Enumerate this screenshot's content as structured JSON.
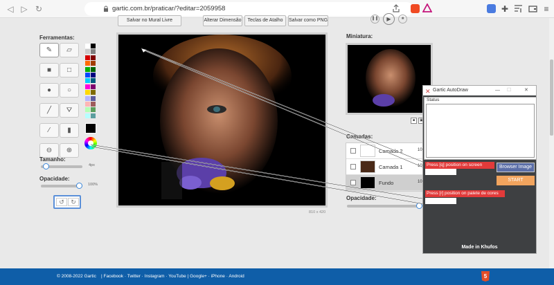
{
  "browser": {
    "url": "gartic.com.br/praticar/?editar=2059958"
  },
  "toolbar": {
    "mural_button": "Salvar no Mural Livre",
    "resize_button": "Alterar Dimensão",
    "shortcuts_button": "Teclas de Atalho",
    "save_png_button": "Salvar como PNG"
  },
  "tools_panel": {
    "heading": "Ferramentas:",
    "size_heading": "Tamanho:",
    "size_value": "4px",
    "size_level": 0.05,
    "opacity_heading": "Opacidade:",
    "opacity_value": "100%",
    "opacity_level": 1.0,
    "tools": [
      "pencil-icon",
      "eraser-icon",
      "filled-rect-icon",
      "rect-outline-icon",
      "filled-circle-icon",
      "circle-outline-icon",
      "line-icon",
      "fill-bucket-icon",
      "eyedropper-icon",
      "blur-icon",
      "zoom-out-icon",
      "zoom-in-icon"
    ],
    "palette": [
      "#ffffff",
      "#000000",
      "#cccccc",
      "#7f7f7f",
      "#d70000",
      "#7f0000",
      "#ff6a00",
      "#a33c00",
      "#00b000",
      "#006400",
      "#0047ff",
      "#00007f",
      "#00cfff",
      "#005d7f",
      "#ff00dc",
      "#7f006e",
      "#ffd800",
      "#7f6a00",
      "#b5b5ff",
      "#5b5b9e",
      "#ffb5b5",
      "#9e5b5b",
      "#b5ffb5",
      "#5b9e5b",
      "#b5ffff",
      "#5b9e9e"
    ],
    "current_color": "#000000"
  },
  "canvas": {
    "dimensions": "810 x 420"
  },
  "right_panel": {
    "thumbnail_heading": "Miniatura:",
    "layers_heading": "Camadas:",
    "layers": [
      {
        "name": "Camada 2",
        "opacity": "10"
      },
      {
        "name": "Camada 1",
        "opacity": "10"
      },
      {
        "name": "Fundo",
        "opacity": "10"
      }
    ],
    "opacity_heading": "Opacidade:",
    "opacity_level": 1.0
  },
  "autodraw": {
    "title": "Gartic AutoDraw",
    "status_label": "Status",
    "press_q": "Press [q] position on screen",
    "press_r": "Press [r] position on palete de cores",
    "browser_image_button": "Browser Image",
    "start_button": "START",
    "credit": "Made in Khufos"
  },
  "footer": {
    "copyright": "© 2008-2022 Gartic",
    "links": [
      "Facebook",
      "Twitter",
      "Instagram",
      "YouTube",
      "Google+",
      "iPhone",
      "Android"
    ],
    "html5_badge": "5"
  },
  "colors": {
    "footer_blue": "#0f5ea8",
    "autodraw_dark": "#3e4042",
    "press_red": "#e23a3a",
    "button_blue": "#5b6ea8",
    "start_orange": "#f2a45e"
  }
}
